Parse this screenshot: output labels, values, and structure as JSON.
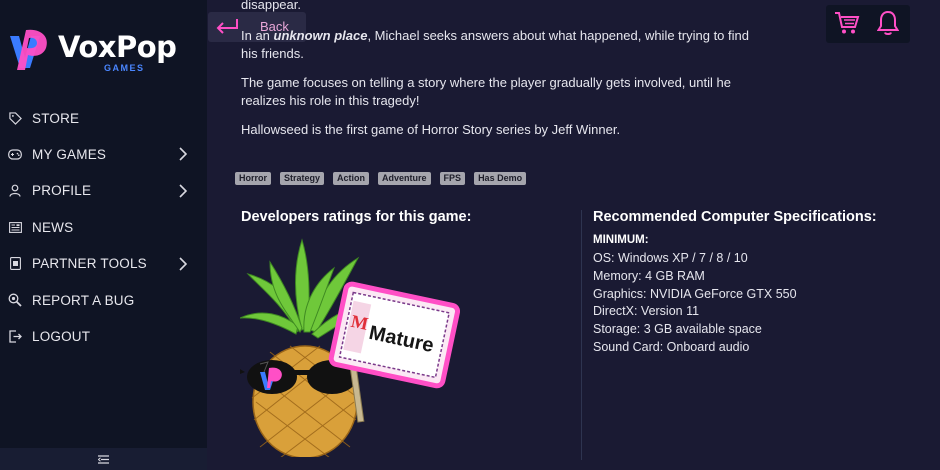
{
  "brand": {
    "name": "VoxPop",
    "sub": "GAMES"
  },
  "nav": {
    "items": [
      {
        "label": "STORE",
        "icon": "tag-icon",
        "chevron": false
      },
      {
        "label": "MY GAMES",
        "icon": "gamepad-icon",
        "chevron": true
      },
      {
        "label": "PROFILE",
        "icon": "user-icon",
        "chevron": true
      },
      {
        "label": "NEWS",
        "icon": "news-icon",
        "chevron": false
      },
      {
        "label": "PARTNER TOOLS",
        "icon": "tools-icon",
        "chevron": true
      },
      {
        "label": "REPORT A BUG",
        "icon": "bug-search-icon",
        "chevron": false
      },
      {
        "label": "LOGOUT",
        "icon": "logout-icon",
        "chevron": false
      }
    ]
  },
  "back": {
    "label": "Back"
  },
  "content": {
    "p_top": "disappear.",
    "p1_before": "In an ",
    "p1_em": "unknown place",
    "p1_after": ", Michael seeks answers about what happened, while trying to find his friends.",
    "p2": "The game focuses on telling a story where the player gradually gets involved, until he realizes his role in this tragedy!",
    "p3": "Hallowseed is the first game of Horror Story series by Jeff Winner."
  },
  "tags": [
    "Horror",
    "Strategy",
    "Action",
    "Adventure",
    "FPS",
    "Has Demo"
  ],
  "ratings": {
    "title": "Developers ratings for this game:",
    "badge_letter": "M",
    "badge_label": "Mature"
  },
  "specs": {
    "title": "Recommended Computer Specifications:",
    "minimum_label": "MINIMUM:",
    "lines": [
      "OS: Windows XP / 7 / 8 / 10",
      "Memory: 4 GB RAM",
      "Graphics: NVIDIA GeForce GTX 550",
      "DirectX: Version 11",
      "Storage: 3 GB available space",
      "Sound Card: Onboard audio"
    ]
  },
  "colors": {
    "accent": "#ff4fc6",
    "brand_blue": "#3a7bff",
    "bg": "#1a1a33",
    "sidebar": "#0f1424"
  }
}
